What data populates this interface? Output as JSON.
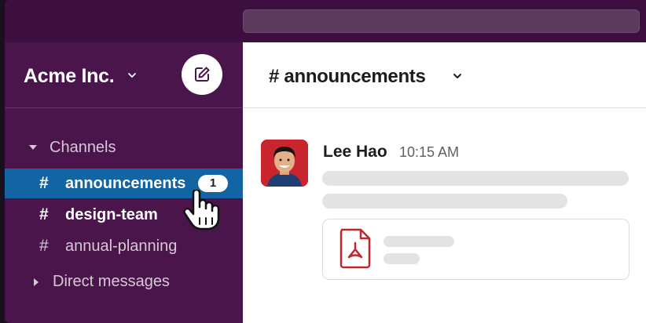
{
  "workspace": {
    "name": "Acme Inc."
  },
  "sidebar": {
    "channels_label": "Channels",
    "channels": [
      {
        "name": "announcements",
        "hash": "#",
        "unread": "1",
        "active": true
      },
      {
        "name": "design-team",
        "hash": "#",
        "bold": true
      },
      {
        "name": "annual-planning",
        "hash": "#"
      }
    ],
    "dm_label": "Direct messages"
  },
  "main": {
    "channel_title": "# announcements",
    "message": {
      "author": "Lee Hao",
      "time": "10:15 AM"
    }
  },
  "colors": {
    "sidebar": "#4a154b",
    "topbar": "#3c0f3f",
    "active": "#1264a3",
    "pdf_red": "#c0262d"
  },
  "icons": [
    "compose-icon",
    "chevron-down-icon",
    "caret-down-icon",
    "caret-right-icon",
    "pointer-hand-icon",
    "pdf-icon"
  ]
}
